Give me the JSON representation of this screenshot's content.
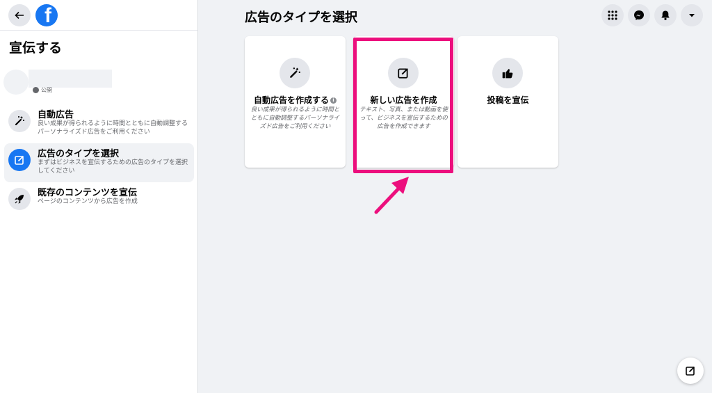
{
  "sidebar": {
    "title": "宣伝する",
    "page_visibility": "公開",
    "items": [
      {
        "label": "自動広告",
        "sub": "良い成果が得られるように時間とともに自動調整するパーソナライズド広告をご利用ください"
      },
      {
        "label": "広告のタイプを選択",
        "sub": "まずはビジネスを宣伝するための広告のタイプを選択してください"
      },
      {
        "label": "既存のコンテンツを宣伝",
        "sub": "ページのコンテンツから広告を作成"
      }
    ]
  },
  "main": {
    "title": "広告のタイプを選択",
    "cards": [
      {
        "title": "自動広告を作成する",
        "desc": "良い成果が得られるように時間とともに自動調整するパーソナライズド広告をご利用ください"
      },
      {
        "title": "新しい広告を作成",
        "desc": "テキスト、写真、または動画を使って、ビジネスを宣伝するための広告を作成できます"
      },
      {
        "title": "投稿を宣伝",
        "desc": ""
      }
    ]
  },
  "colors": {
    "brand": "#1877f2",
    "highlight": "#ec0f7d",
    "muted": "#65676b"
  },
  "icons": [
    "back-arrow-icon",
    "facebook-logo",
    "magic-wand-icon",
    "edit-square-icon",
    "rocket-icon",
    "thumbs-up-icon",
    "menu-grid-icon",
    "messenger-icon",
    "bell-icon",
    "caret-down-icon",
    "compose-icon"
  ]
}
